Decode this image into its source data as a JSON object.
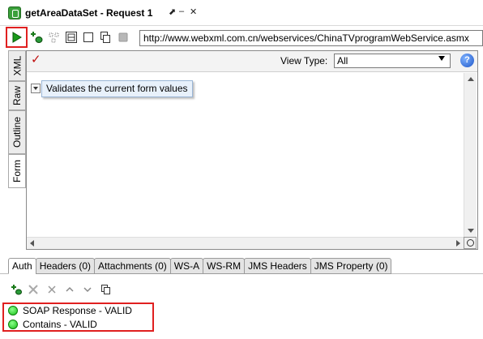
{
  "window": {
    "title": "getAreaDataSet - Request 1",
    "controls": [
      "⬈",
      "–",
      "✕"
    ]
  },
  "toolbar": {
    "url": "http://www.webxml.com.cn/webservices/ChinaTVprogramWebService.asmx",
    "icons": [
      "play-icon",
      "add-endpoint-icon",
      "create-test-icon",
      "tile-icon",
      "stop-icon",
      "copy-icon",
      "cancel-icon"
    ]
  },
  "vertical_tabs": [
    "XML",
    "Raw",
    "Outline",
    "Form"
  ],
  "form_panel": {
    "view_type_label": "View Type:",
    "view_type_value": "All",
    "tooltip": "Validates the current form values",
    "help_label": "?"
  },
  "bottom_tabs": [
    "Auth",
    "Headers (0)",
    "Attachments (0)",
    "WS-A",
    "WS-RM",
    "JMS Headers",
    "JMS Property (0)"
  ],
  "assertions": [
    {
      "label": "SOAP Response - VALID",
      "status_color": "#22cc22"
    },
    {
      "label": "Contains - VALID",
      "status_color": "#22cc22"
    }
  ],
  "colors": {
    "highlight": "#e02020",
    "valid": "#22cc22",
    "check": "#c01010"
  }
}
